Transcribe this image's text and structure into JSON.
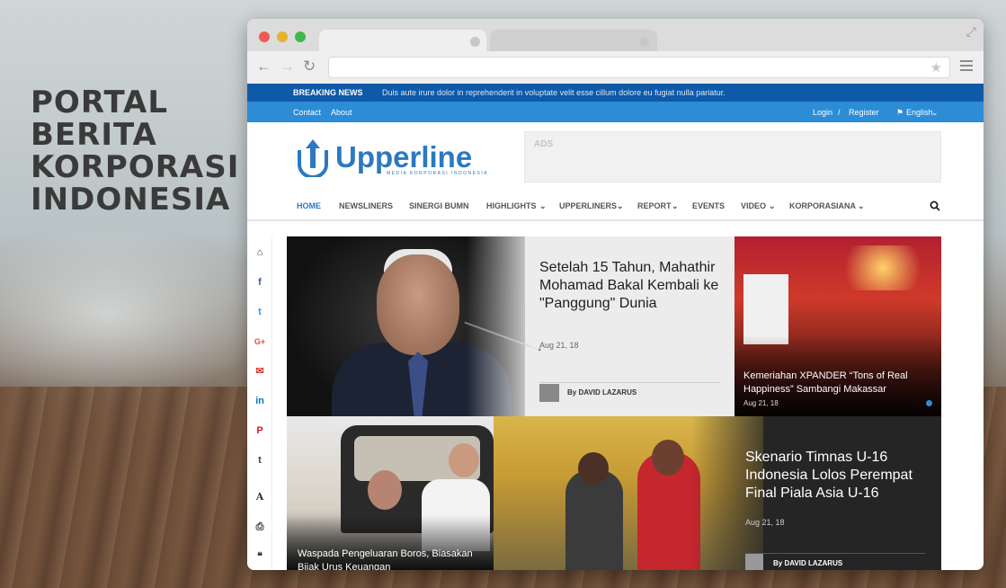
{
  "promo": {
    "lines": [
      "PORTAL",
      "BERITA",
      "KORPORASI",
      "INDONESIA"
    ]
  },
  "browser": {
    "nav_back": "←",
    "nav_forward": "→",
    "nav_reload": "↻",
    "star": "★",
    "expand": "⤢"
  },
  "breaking": {
    "label": "BREAKING NEWS",
    "text": "Duis aute irure dolor in reprehenderit in voluptate velit esse cillum dolore eu fugiat nulla pariatur."
  },
  "topnav": {
    "contact": "Contact",
    "about": "About",
    "login": "Login",
    "sep": "/",
    "register": "Register",
    "language": "English"
  },
  "logo": {
    "name": "Upperline",
    "tagline": "MEDIA KORPORASI INDONESIA"
  },
  "ads": {
    "label": "ADS"
  },
  "mainnav": {
    "items": [
      "HOME",
      "NEWSLINERS",
      "SINERGI BUMN",
      "HIGHLIGHTS",
      "UPPERLINERS",
      "REPORT",
      "EVENTS",
      "VIDEO",
      "KORPORASIANA"
    ]
  },
  "share": {
    "items": [
      "home",
      "facebook",
      "twitter",
      "google-plus",
      "email",
      "linkedin",
      "pinterest",
      "tumblr",
      "font",
      "print",
      "comments"
    ]
  },
  "articles": [
    {
      "title": "Setelah 15 Tahun, Mahathir Mohamad Bakal Kembali ke \"Panggung\" Dunia",
      "date": "Aug 21, 18",
      "author": "By DAVID LAZARUS"
    },
    {
      "title": "Kemeriahan XPANDER “Tons of Real Happiness” Sambangi Makassar",
      "date": "Aug 21, 18"
    },
    {
      "title": "Waspada Pengeluaran Boros, Biasakan Bijak Urus Keuangan"
    },
    {
      "title": "Skenario Timnas U-16 Indonesia Lolos Perempat Final Piala Asia U-16",
      "date": "Aug 21, 18",
      "author": "By DAVID LAZARUS"
    }
  ],
  "colors": {
    "brand": "#2c79c1",
    "breaking_bg": "#0f5aa8",
    "topnav_bg": "#2d8cd6"
  }
}
